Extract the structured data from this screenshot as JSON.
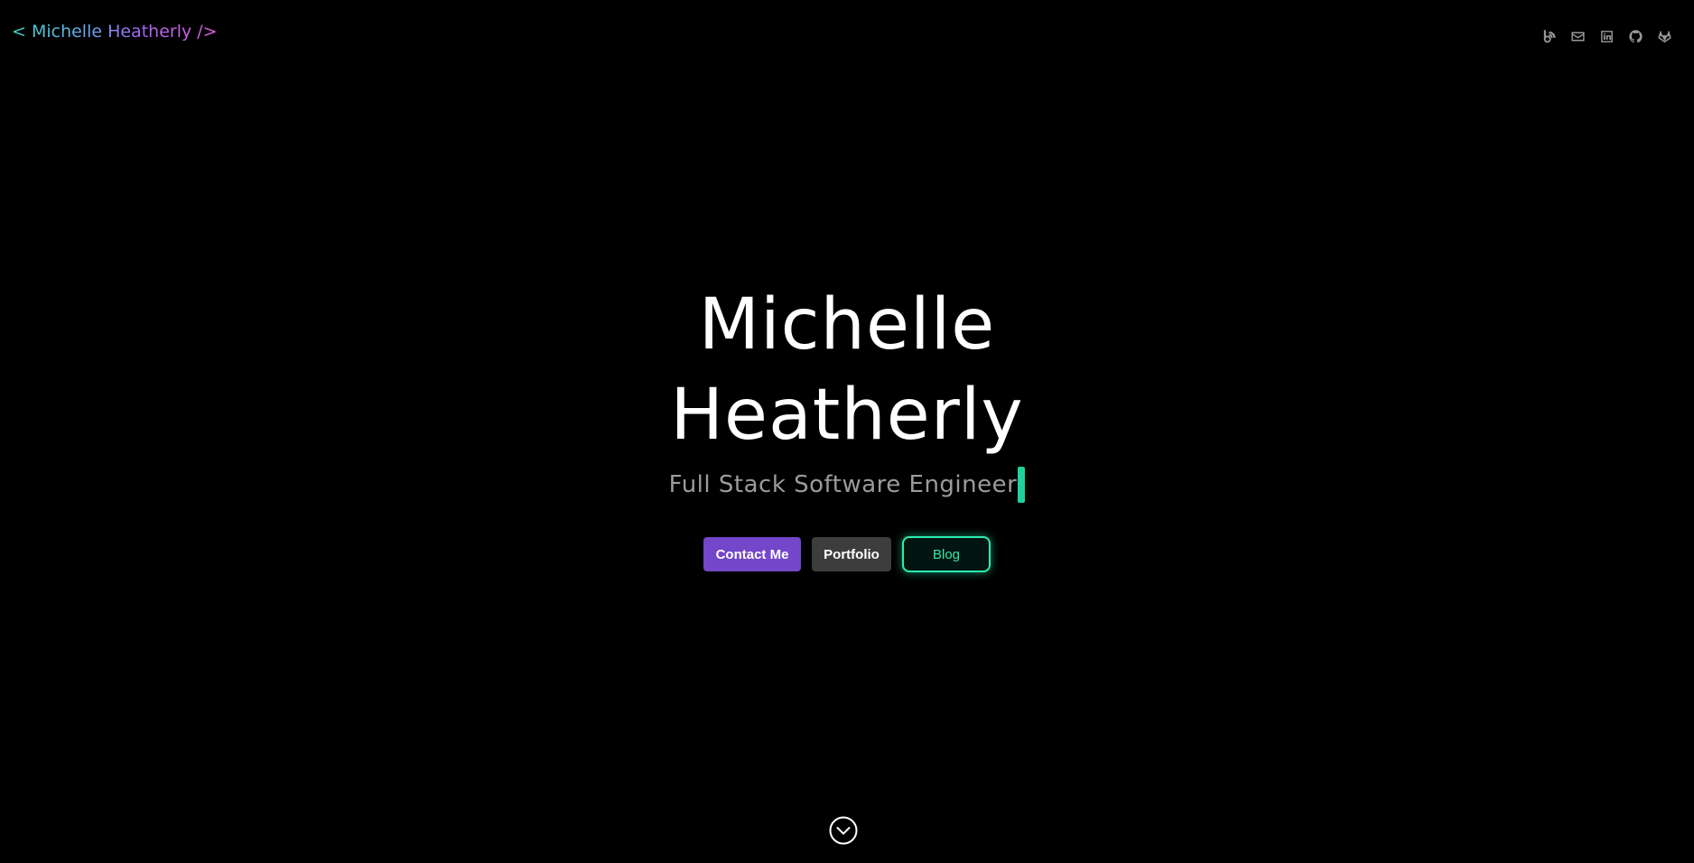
{
  "header": {
    "logo_text": "< Michelle Heatherly />",
    "social_links": [
      {
        "icon": "blog-icon",
        "label": "Blog"
      },
      {
        "icon": "email-icon",
        "label": "Email"
      },
      {
        "icon": "linkedin-icon",
        "label": "LinkedIn"
      },
      {
        "icon": "github-icon",
        "label": "GitHub"
      },
      {
        "icon": "gitlab-icon",
        "label": "GitLab"
      }
    ]
  },
  "hero": {
    "name_line1": "Michelle",
    "name_line2": "Heatherly",
    "role": "Full Stack Software Engineer",
    "buttons": {
      "contact": "Contact Me",
      "portfolio": "Portfolio",
      "blog": "Blog"
    }
  },
  "footer": {
    "scroll_icon": "chevron-down-circle-icon"
  },
  "colors": {
    "background": "#000000",
    "accent_purple": "#7446c9",
    "accent_green": "#2af0b0",
    "muted_gray": "#9b9b9b",
    "button_gray": "#3d3d3d"
  }
}
